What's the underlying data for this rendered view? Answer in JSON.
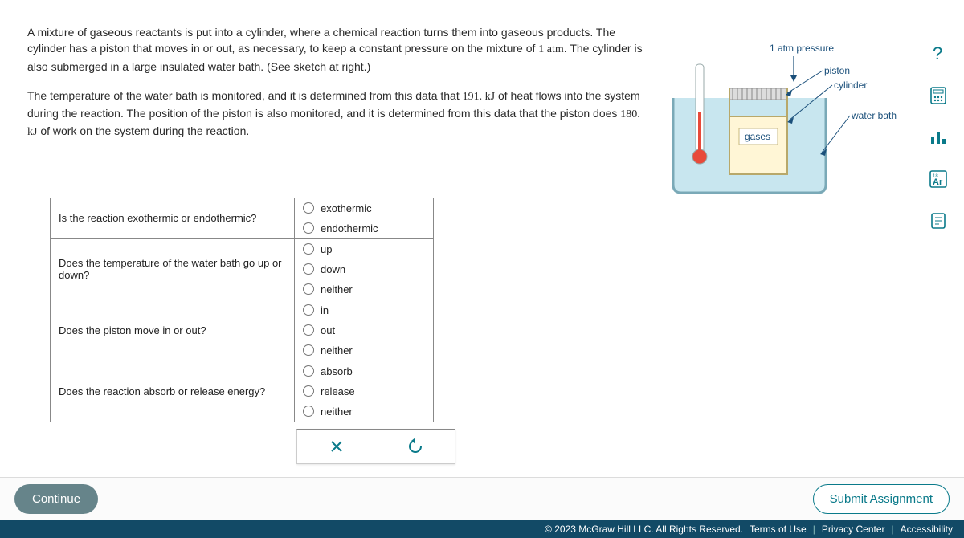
{
  "prompt": {
    "p1_a": "A mixture of gaseous reactants is put into a cylinder, where a chemical reaction turns them into gaseous products. The cylinder has a piston that moves in or out, as necessary, to keep a constant pressure on the mixture of ",
    "p1_val": "1 atm",
    "p1_b": ". The cylinder is also submerged in a large insulated water bath. (See sketch at right.)",
    "p2_a": "The temperature of the water bath is monitored, and it is determined from this data that ",
    "p2_val1": "191. kJ",
    "p2_b": " of heat flows into the system during the reaction. The position of the piston is also monitored, and it is determined from this data that the piston does ",
    "p2_val2": "180. kJ",
    "p2_c": " of work on the system during the reaction."
  },
  "diagram": {
    "pressure_label": "1 atm pressure",
    "piston_label": "piston",
    "cylinder_label": "cylinder",
    "waterbath_label": "water bath",
    "gases_label": "gases"
  },
  "questions": [
    {
      "q": "Is the reaction exothermic or endothermic?",
      "options": [
        "exothermic",
        "endothermic"
      ]
    },
    {
      "q": "Does the temperature of the water bath go up or down?",
      "options": [
        "up",
        "down",
        "neither"
      ]
    },
    {
      "q": "Does the piston move in or out?",
      "options": [
        "in",
        "out",
        "neither"
      ]
    },
    {
      "q": "Does the reaction absorb or release energy?",
      "options": [
        "absorb",
        "release",
        "neither"
      ]
    }
  ],
  "buttons": {
    "continue": "Continue",
    "submit": "Submit Assignment"
  },
  "footer": {
    "copyright": "© 2023 McGraw Hill LLC. All Rights Reserved.",
    "terms": "Terms of Use",
    "privacy": "Privacy Center",
    "accessibility": "Accessibility"
  }
}
